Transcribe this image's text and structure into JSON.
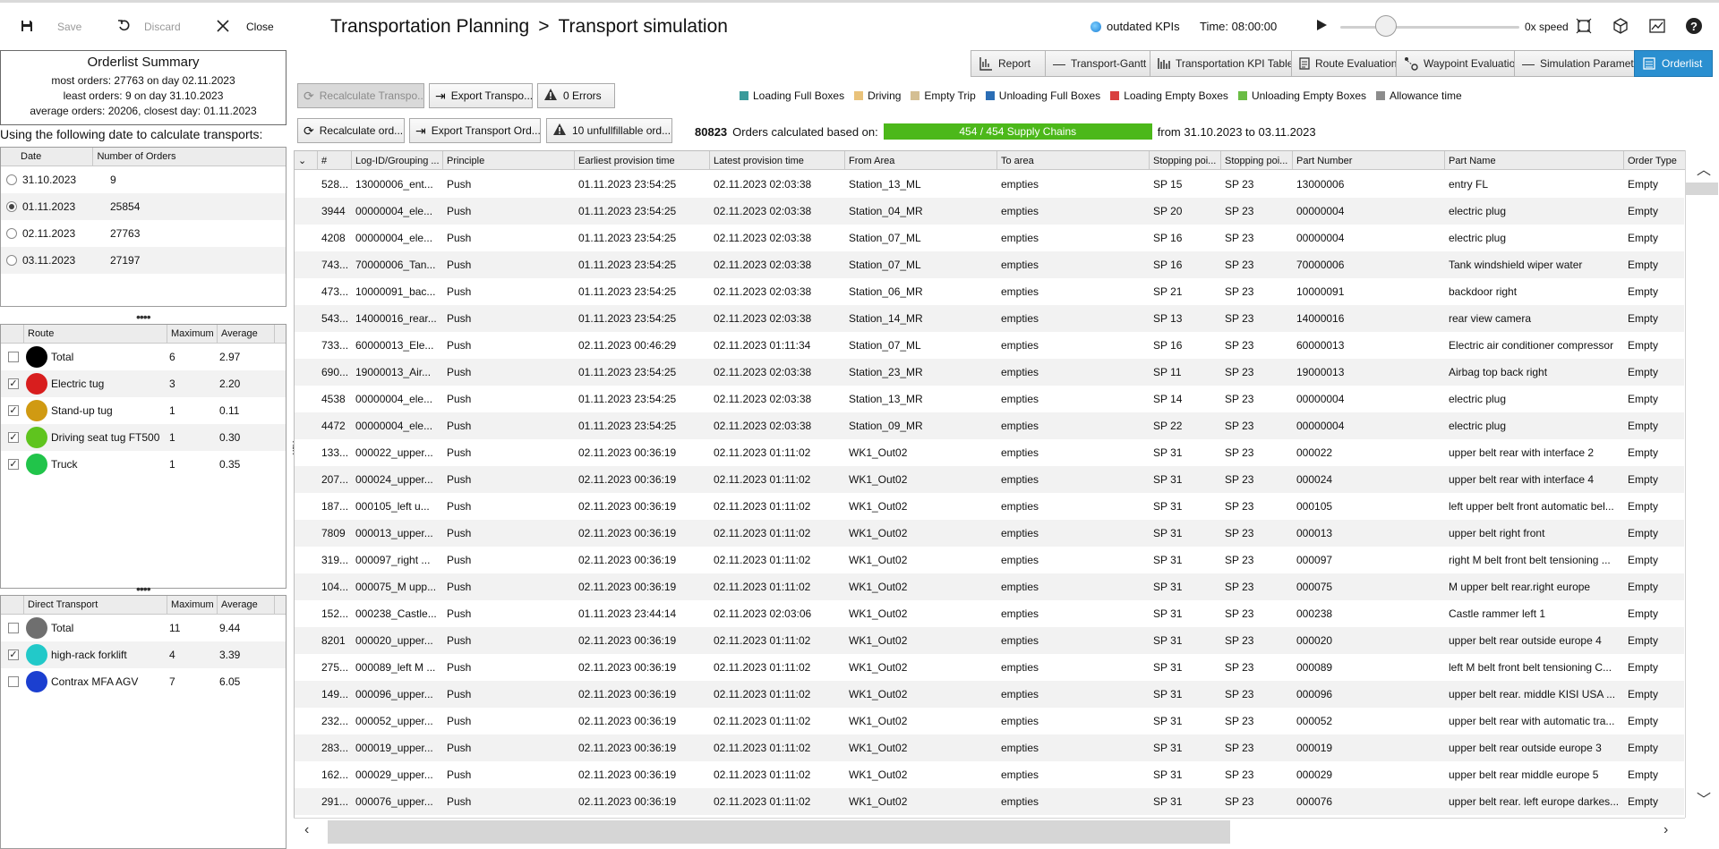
{
  "toolbar": {
    "save_label": "Save",
    "discard_label": "Discard",
    "close_label": "Close"
  },
  "title": {
    "part1": "Transportation Planning",
    "separator": ">",
    "part2": "Transport simulation"
  },
  "status": {
    "kpi_label": "outdated KPIs",
    "time_label": "Time: 08:00:00",
    "speed_label": "0x speed"
  },
  "views": [
    "Report",
    "Transport-Gantt",
    "Transportation KPI Table",
    "Route Evaluation",
    "Waypoint Evaluation",
    "Simulation Parameter",
    "Orderlist"
  ],
  "actions": {
    "recalc_transports": "Recalculate Transpo...",
    "export_transports": "Export Transpo...",
    "errors": "0 Errors",
    "recalc_orders": "Recalculate ord...",
    "export_orders": "Export Transport Ord...",
    "unfulfillable": "10 unfullfillable ord..."
  },
  "legend": [
    {
      "label": "Loading Full Boxes",
      "color": "#3a9a9a"
    },
    {
      "label": "Driving",
      "color": "#e9c27a"
    },
    {
      "label": "Empty Trip",
      "color": "#d4bf93"
    },
    {
      "label": "Unloading Full Boxes",
      "color": "#2a6db5"
    },
    {
      "label": "Loading Empty Boxes",
      "color": "#d9403f"
    },
    {
      "label": "Unloading Empty Boxes",
      "color": "#6bbd45"
    },
    {
      "label": "Allowance time",
      "color": "#8c8c8c"
    }
  ],
  "calc": {
    "count": "80823",
    "text": "Orders calculated based on:",
    "progress_label": "454 / 454 Supply Chains",
    "progress": 1.0,
    "range": "from 31.10.2023 to 03.11.2023"
  },
  "summary": {
    "title": "Orderlist Summary",
    "most": "most orders: 27763 on day 02.11.2023",
    "least": "least orders: 9 on day 31.10.2023",
    "average": "average orders: 20206, closest day: 01.11.2023"
  },
  "using_label": "Using the following date to calculate transports:",
  "dates": {
    "headers": [
      "Date",
      "Number of Orders"
    ],
    "rows": [
      {
        "date": "31.10.2023",
        "orders": "9",
        "selected": false
      },
      {
        "date": "01.11.2023",
        "orders": "25854",
        "selected": true
      },
      {
        "date": "02.11.2023",
        "orders": "27763",
        "selected": false
      },
      {
        "date": "03.11.2023",
        "orders": "27197",
        "selected": false
      }
    ]
  },
  "routes": {
    "headers": [
      "Route",
      "Maximum",
      "Average"
    ],
    "rows": [
      {
        "name": "Total",
        "max": "6",
        "avg": "2.97",
        "checked": false,
        "color": "#000000"
      },
      {
        "name": "Electric tug",
        "max": "3",
        "avg": "2.20",
        "checked": true,
        "color": "#d81e1e"
      },
      {
        "name": "Stand-up tug",
        "max": "1",
        "avg": "0.11",
        "checked": true,
        "color": "#d09a12"
      },
      {
        "name": "Driving seat tug FT500",
        "max": "1",
        "avg": "0.30",
        "checked": true,
        "color": "#5fc41e"
      },
      {
        "name": "Truck",
        "max": "1",
        "avg": "0.35",
        "checked": true,
        "color": "#21c44a"
      }
    ]
  },
  "direct": {
    "headers": [
      "Direct Transport",
      "Maximum",
      "Average"
    ],
    "rows": [
      {
        "name": "Total",
        "max": "11",
        "avg": "9.44",
        "checked": false,
        "color": "#6f6f6f"
      },
      {
        "name": "high-rack forklift",
        "max": "4",
        "avg": "3.39",
        "checked": true,
        "color": "#22c9c9"
      },
      {
        "name": "Contrax MFA AGV",
        "max": "7",
        "avg": "6.05",
        "checked": false,
        "color": "#1b3fd0"
      }
    ]
  },
  "orders": {
    "headers": [
      "#",
      "Log-ID/Grouping ...",
      "Principle",
      "Earliest provision time",
      "Latest provision time",
      "From Area",
      "To area",
      "Stopping poi...",
      "Stopping poi...",
      "Part Number",
      "Part Name",
      "Order Type"
    ],
    "rows": [
      [
        "528...",
        "13000006_ent...",
        "Push",
        "01.11.2023 23:54:25",
        "02.11.2023 02:03:38",
        "Station_13_ML",
        "empties",
        "SP 15",
        "SP 23",
        "13000006",
        "entry FL",
        "Empty"
      ],
      [
        "3944",
        "00000004_ele...",
        "Push",
        "01.11.2023 23:54:25",
        "02.11.2023 02:03:38",
        "Station_04_MR",
        "empties",
        "SP 20",
        "SP 23",
        "00000004",
        "electric plug",
        "Empty"
      ],
      [
        "4208",
        "00000004_ele...",
        "Push",
        "01.11.2023 23:54:25",
        "02.11.2023 02:03:38",
        "Station_07_ML",
        "empties",
        "SP 16",
        "SP 23",
        "00000004",
        "electric plug",
        "Empty"
      ],
      [
        "743...",
        "70000006_Tan...",
        "Push",
        "01.11.2023 23:54:25",
        "02.11.2023 02:03:38",
        "Station_07_ML",
        "empties",
        "SP 16",
        "SP 23",
        "70000006",
        "Tank windshield wiper water",
        "Empty"
      ],
      [
        "473...",
        "10000091_bac...",
        "Push",
        "01.11.2023 23:54:25",
        "02.11.2023 02:03:38",
        "Station_06_MR",
        "empties",
        "SP 21",
        "SP 23",
        "10000091",
        "backdoor right",
        "Empty"
      ],
      [
        "543...",
        "14000016_rear...",
        "Push",
        "01.11.2023 23:54:25",
        "02.11.2023 02:03:38",
        "Station_14_MR",
        "empties",
        "SP 13",
        "SP 23",
        "14000016",
        "rear view camera",
        "Empty"
      ],
      [
        "733...",
        "60000013_Ele...",
        "Push",
        "02.11.2023 00:46:29",
        "02.11.2023 01:11:34",
        "Station_07_ML",
        "empties",
        "SP 16",
        "SP 23",
        "60000013",
        "Electric air conditioner compressor",
        "Empty"
      ],
      [
        "690...",
        "19000013_Air...",
        "Push",
        "01.11.2023 23:54:25",
        "02.11.2023 02:03:38",
        "Station_23_MR",
        "empties",
        "SP 11",
        "SP 23",
        "19000013",
        "Airbag top back right",
        "Empty"
      ],
      [
        "4538",
        "00000004_ele...",
        "Push",
        "01.11.2023 23:54:25",
        "02.11.2023 02:03:38",
        "Station_13_MR",
        "empties",
        "SP 14",
        "SP 23",
        "00000004",
        "electric plug",
        "Empty"
      ],
      [
        "4472",
        "00000004_ele...",
        "Push",
        "01.11.2023 23:54:25",
        "02.11.2023 02:03:38",
        "Station_09_MR",
        "empties",
        "SP 22",
        "SP 23",
        "00000004",
        "electric plug",
        "Empty"
      ],
      [
        "133...",
        "000022_upper...",
        "Push",
        "02.11.2023 00:36:19",
        "02.11.2023 01:11:02",
        "WK1_Out02",
        "empties",
        "SP 31",
        "SP 23",
        "000022",
        "upper belt rear with interface 2",
        "Empty"
      ],
      [
        "207...",
        "000024_upper...",
        "Push",
        "02.11.2023 00:36:19",
        "02.11.2023 01:11:02",
        "WK1_Out02",
        "empties",
        "SP 31",
        "SP 23",
        "000024",
        "upper belt rear with interface 4",
        "Empty"
      ],
      [
        "187...",
        "000105_left u...",
        "Push",
        "02.11.2023 00:36:19",
        "02.11.2023 01:11:02",
        "WK1_Out02",
        "empties",
        "SP 31",
        "SP 23",
        "000105",
        "left upper belt front automatic bel...",
        "Empty"
      ],
      [
        "7809",
        "000013_upper...",
        "Push",
        "02.11.2023 00:36:19",
        "02.11.2023 01:11:02",
        "WK1_Out02",
        "empties",
        "SP 31",
        "SP 23",
        "000013",
        "upper belt right front",
        "Empty"
      ],
      [
        "319...",
        "000097_right ...",
        "Push",
        "02.11.2023 00:36:19",
        "02.11.2023 01:11:02",
        "WK1_Out02",
        "empties",
        "SP 31",
        "SP 23",
        "000097",
        "right M belt front belt tensioning ...",
        "Empty"
      ],
      [
        "104...",
        "000075_M upp...",
        "Push",
        "02.11.2023 00:36:19",
        "02.11.2023 01:11:02",
        "WK1_Out02",
        "empties",
        "SP 31",
        "SP 23",
        "000075",
        "M upper belt rear.right europe",
        "Empty"
      ],
      [
        "152...",
        "000238_Castle...",
        "Push",
        "01.11.2023 23:44:14",
        "02.11.2023 02:03:06",
        "WK1_Out02",
        "empties",
        "SP 31",
        "SP 23",
        "000238",
        "Castle rammer  left 1",
        "Empty"
      ],
      [
        "8201",
        "000020_upper...",
        "Push",
        "02.11.2023 00:36:19",
        "02.11.2023 01:11:02",
        "WK1_Out02",
        "empties",
        "SP 31",
        "SP 23",
        "000020",
        "upper belt rear outside europe 4",
        "Empty"
      ],
      [
        "275...",
        "000089_left M ...",
        "Push",
        "02.11.2023 00:36:19",
        "02.11.2023 01:11:02",
        "WK1_Out02",
        "empties",
        "SP 31",
        "SP 23",
        "000089",
        "left M belt front  belt tensioning C...",
        "Empty"
      ],
      [
        "149...",
        "000096_upper...",
        "Push",
        "02.11.2023 00:36:19",
        "02.11.2023 01:11:02",
        "WK1_Out02",
        "empties",
        "SP 31",
        "SP 23",
        "000096",
        "upper belt rear. middle KISI USA ...",
        "Empty"
      ],
      [
        "232...",
        "000052_upper...",
        "Push",
        "02.11.2023 00:36:19",
        "02.11.2023 01:11:02",
        "WK1_Out02",
        "empties",
        "SP 31",
        "SP 23",
        "000052",
        "upper belt rear with automatic tra...",
        "Empty"
      ],
      [
        "283...",
        "000019_upper...",
        "Push",
        "02.11.2023 00:36:19",
        "02.11.2023 01:11:02",
        "WK1_Out02",
        "empties",
        "SP 31",
        "SP 23",
        "000019",
        "upper belt rear outside europe 3",
        "Empty"
      ],
      [
        "162...",
        "000029_upper...",
        "Push",
        "02.11.2023 00:36:19",
        "02.11.2023 01:11:02",
        "WK1_Out02",
        "empties",
        "SP 31",
        "SP 23",
        "000029",
        "upper belt rear middle europe 5",
        "Empty"
      ],
      [
        "291...",
        "000076_upper...",
        "Push",
        "02.11.2023 00:36:19",
        "02.11.2023 01:11:02",
        "WK1_Out02",
        "empties",
        "SP 31",
        "SP 23",
        "000076",
        "upper belt rear. left europe darkes...",
        "Empty"
      ]
    ]
  }
}
